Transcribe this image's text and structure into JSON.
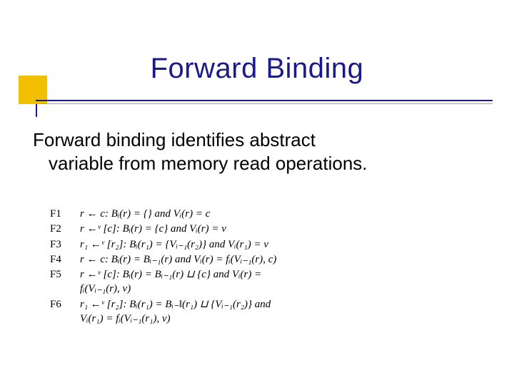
{
  "title": "Forward Binding",
  "body": {
    "line1": "Forward binding identifies abstract",
    "line2": "variable from memory read operations."
  },
  "rules": {
    "F1": {
      "tag": "F1",
      "text": "r ← c:  Bᵢ(r) = {} and Vᵢ(r) = c"
    },
    "F2": {
      "tag": "F2",
      "text": "r ←ᵛ [c]:  Bᵢ(r) = {c} and Vᵢ(r) = v"
    },
    "F3": {
      "tag": "F3",
      "text": "r₁ ←ᵛ [r₂]:  Bᵢ(r₁) = {Vᵢ₋₁(r₂)} and Vᵢ(r₁) = v"
    },
    "F4": {
      "tag": "F4",
      "text": "r ←  c:  Bᵢ(r) = Bᵢ₋₁(r) and Vᵢ(r) = fᵢ(Vᵢ₋₁(r), c)"
    },
    "F5": {
      "tag": "F5",
      "text": "r ←ᵛ [c]:  Bᵢ(r) = Bᵢ₋₁(r) ⊔ {c} and Vᵢ(r) =",
      "cont": "fᵢ(Vᵢ₋₁(r), v)"
    },
    "F6": {
      "tag": "F6",
      "text": "r₁ ←ᵛ [r₂]:  Bᵢ(r₁) = Bᵢ₋‖(r₁) ⊔ {Vᵢ₋₁(r₂)} and",
      "cont": "Vᵢ(r₁) = fᵢ(Vᵢ₋₁(r₁), v)"
    }
  }
}
